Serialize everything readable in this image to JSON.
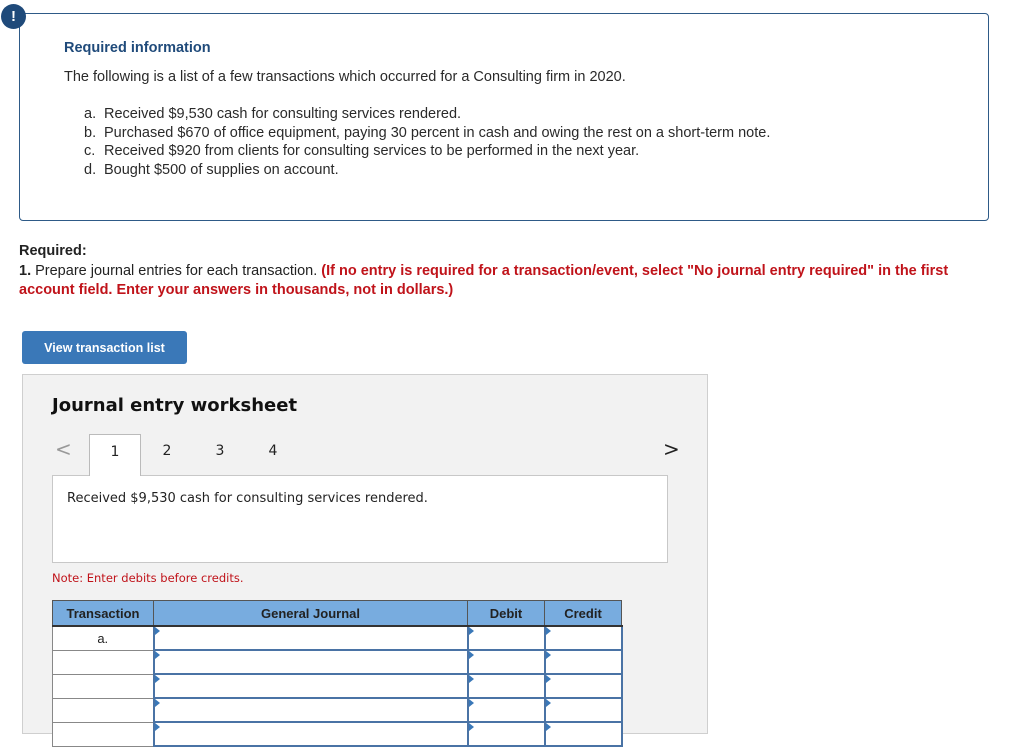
{
  "info": {
    "badge": "!",
    "title": "Required information",
    "intro": "The following is a list of a few transactions which occurred for a Consulting firm in 2020.",
    "transactions": [
      {
        "letter": "a.",
        "text": "Received $9,530 cash for consulting services rendered."
      },
      {
        "letter": "b.",
        "text": "Purchased $670 of office equipment, paying 30 percent in cash and owing the rest on a short-term note."
      },
      {
        "letter": "c.",
        "text": "Received $920 from clients for consulting services to be performed in the next year."
      },
      {
        "letter": "d.",
        "text": "Bought $500 of supplies on account."
      }
    ]
  },
  "required": {
    "heading": "Required:",
    "number": "1.",
    "instruction": " Prepare journal entries for each transaction. ",
    "note": "(If no entry is required for a transaction/event, select \"No journal entry required\" in the first account field. Enter your answers in thousands, not in dollars.)"
  },
  "view_button": "View transaction list",
  "worksheet": {
    "title": "Journal entry worksheet",
    "prev_icon": "<",
    "next_icon": ">",
    "tabs": [
      "1",
      "2",
      "3",
      "4"
    ],
    "active_tab": "1",
    "description": "Received $9,530 cash for consulting services rendered.",
    "note": "Note: Enter debits before credits.",
    "table": {
      "headers": [
        "Transaction",
        "General Journal",
        "Debit",
        "Credit"
      ],
      "rows": [
        {
          "transaction": "a.",
          "account": "",
          "debit": "",
          "credit": ""
        },
        {
          "transaction": "",
          "account": "",
          "debit": "",
          "credit": ""
        },
        {
          "transaction": "",
          "account": "",
          "debit": "",
          "credit": ""
        },
        {
          "transaction": "",
          "account": "",
          "debit": "",
          "credit": ""
        },
        {
          "transaction": "",
          "account": "",
          "debit": "",
          "credit": ""
        }
      ]
    }
  },
  "colors": {
    "accent": "#3a78b8",
    "title_blue": "#1f4a7a",
    "warning_red": "#c0131a",
    "table_header": "#78acdf"
  }
}
